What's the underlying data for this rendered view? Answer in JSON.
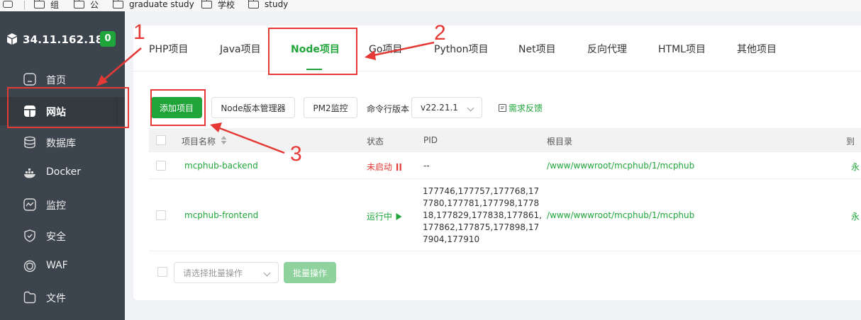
{
  "bookmarks": {
    "items": [
      {
        "label": "组",
        "icon": "folder-icon"
      },
      {
        "label": "公",
        "icon": "folder-icon"
      },
      {
        "label": "graduate study",
        "icon": "folder-icon"
      },
      {
        "label": "学校",
        "icon": "folder-icon"
      },
      {
        "label": "study",
        "icon": "folder-icon"
      }
    ]
  },
  "sidebar": {
    "server_ip": "34.11.162.187",
    "badge": "0",
    "items": [
      {
        "label": "首页",
        "icon": "home-icon"
      },
      {
        "label": "网站",
        "icon": "website-icon",
        "active": true
      },
      {
        "label": "数据库",
        "icon": "database-icon"
      },
      {
        "label": "Docker",
        "icon": "docker-icon"
      },
      {
        "label": "监控",
        "icon": "monitor-icon"
      },
      {
        "label": "安全",
        "icon": "shield-icon"
      },
      {
        "label": "WAF",
        "icon": "waf-icon"
      },
      {
        "label": "文件",
        "icon": "file-icon"
      }
    ]
  },
  "tabs": [
    {
      "label": "PHP项目"
    },
    {
      "label": "Java项目"
    },
    {
      "label": "Node项目",
      "active": true
    },
    {
      "label": "Go项目"
    },
    {
      "label": "Python项目"
    },
    {
      "label": "Net项目"
    },
    {
      "label": "反向代理"
    },
    {
      "label": "HTML项目"
    },
    {
      "label": "其他项目"
    }
  ],
  "toolbar": {
    "add_project": "添加项目",
    "node_version_manager": "Node版本管理器",
    "pm2_monitor": "PM2监控",
    "cli_version_label": "命令行版本",
    "cli_version_value": "v22.21.1",
    "feedback": "需求反馈"
  },
  "table": {
    "headers": {
      "name": "项目名称",
      "status": "状态",
      "pid": "PID",
      "root": "根目录",
      "extra": "到"
    },
    "rows": [
      {
        "name": "mcphub-backend",
        "status": "未启动",
        "pid": "--",
        "root": "/www/wwwroot/mcphub/1/mcphub",
        "extra": "永"
      },
      {
        "name": "mcphub-frontend",
        "status": "运行中",
        "pid": "177746,177757,177768,177780,177781,177798,177818,177829,177838,177861,177862,177875,177898,177904,177910",
        "root": "/www/wwwroot/mcphub/1/mcphub",
        "extra": "永"
      }
    ]
  },
  "footer": {
    "batch_placeholder": "请选择批量操作",
    "batch_button": "批量操作"
  },
  "annotations": {
    "labels": [
      "1",
      "2",
      "3"
    ],
    "color": "#e53935"
  },
  "colors": {
    "accent": "#20a53a",
    "sidebar_bg": "#3c444d",
    "danger": "#e53935"
  }
}
